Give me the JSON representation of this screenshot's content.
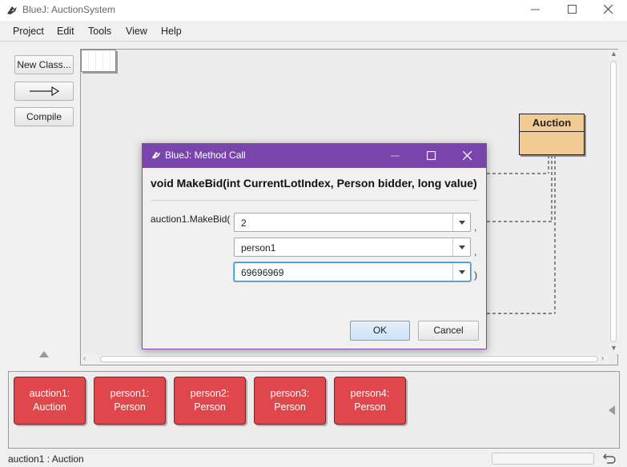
{
  "window": {
    "title": "BlueJ:  AuctionSystem"
  },
  "menu": [
    "Project",
    "Edit",
    "Tools",
    "View",
    "Help"
  ],
  "toolbar": {
    "new_class_label": "New Class...",
    "compile_label": "Compile"
  },
  "diagram": {
    "class_name": "Auction"
  },
  "dialog": {
    "title": "BlueJ:  Method Call",
    "signature": "void MakeBid(int CurrentLotIndex, Person bidder, long value)",
    "call_prefix": "auction1.MakeBid(",
    "params": [
      {
        "value": "2",
        "separator": ","
      },
      {
        "value": "person1",
        "separator": ","
      },
      {
        "value": "69696969",
        "separator": ")"
      }
    ],
    "ok_label": "OK",
    "cancel_label": "Cancel"
  },
  "bench": {
    "objects": [
      {
        "name": "auction1:",
        "type": "Auction"
      },
      {
        "name": "person1:",
        "type": "Person"
      },
      {
        "name": "person2:",
        "type": "Person"
      },
      {
        "name": "person3:",
        "type": "Person"
      },
      {
        "name": "person4:",
        "type": "Person"
      }
    ]
  },
  "status": {
    "text": "auction1 : Auction"
  },
  "icons": [
    "bluej-icon",
    "minimize-icon",
    "maximize-icon",
    "close-icon",
    "arrow-icon",
    "triangle-up-icon",
    "triangle-left-icon",
    "dropdown-icon",
    "undo-icon"
  ]
}
